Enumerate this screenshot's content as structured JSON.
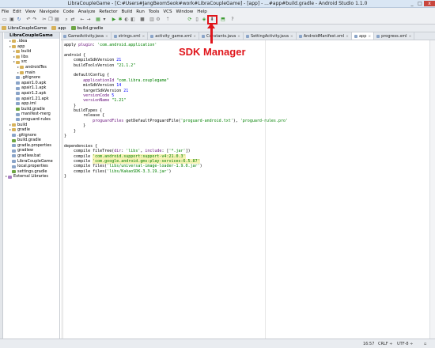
{
  "window": {
    "title": "LibraCoupleGame - [C:#Users#JangBeomSeok#work#LibraCoupleGame] - [app] - ...#app#build.gradle - Android Studio 1.1.0",
    "controls": [
      "_",
      "□",
      "x"
    ]
  },
  "menu": [
    "File",
    "Edit",
    "View",
    "Navigate",
    "Code",
    "Analyze",
    "Refactor",
    "Build",
    "Run",
    "Tools",
    "VCS",
    "Window",
    "Help"
  ],
  "annotation": {
    "label": "SDK Manager",
    "color": "#e0151b"
  },
  "breadcrumbs": [
    "LibraCoupleGame",
    "app",
    "build.gradle"
  ],
  "project_tree": {
    "header": "LibraCoupleGame",
    "items": [
      {
        "label": ".idea",
        "depth": 1,
        "icon": "folder"
      },
      {
        "label": "app",
        "depth": 1,
        "icon": "folder"
      },
      {
        "label": "build",
        "depth": 2,
        "icon": "folder"
      },
      {
        "label": "libs",
        "depth": 2,
        "icon": "folder"
      },
      {
        "label": "src",
        "depth": 2,
        "icon": "folder"
      },
      {
        "label": "androidTes",
        "depth": 3,
        "icon": "folder"
      },
      {
        "label": "main",
        "depth": 3,
        "icon": "folder"
      },
      {
        "label": ".gitignore",
        "depth": 2,
        "icon": "file"
      },
      {
        "label": "apair1.0.apk",
        "depth": 2,
        "icon": "file"
      },
      {
        "label": "apair1.1.apk",
        "depth": 2,
        "icon": "file"
      },
      {
        "label": "apair1.2.apk",
        "depth": 2,
        "icon": "file"
      },
      {
        "label": "apair1.21.apk",
        "depth": 2,
        "icon": "file"
      },
      {
        "label": "app.iml",
        "depth": 2,
        "icon": "file"
      },
      {
        "label": "build.gradle",
        "depth": 2,
        "icon": "gradle"
      },
      {
        "label": "manifest-merg",
        "depth": 2,
        "icon": "file"
      },
      {
        "label": "proguard-rules",
        "depth": 2,
        "icon": "file"
      },
      {
        "label": "build",
        "depth": 1,
        "icon": "folder"
      },
      {
        "label": "gradle",
        "depth": 1,
        "icon": "folder"
      },
      {
        "label": ".gitignore",
        "depth": 1,
        "icon": "file"
      },
      {
        "label": "build.gradle",
        "depth": 1,
        "icon": "gradle"
      },
      {
        "label": "gradle.properties",
        "depth": 1,
        "icon": "file"
      },
      {
        "label": "gradlew",
        "depth": 1,
        "icon": "file"
      },
      {
        "label": "gradlew.bat",
        "depth": 1,
        "icon": "file"
      },
      {
        "label": "LibraCoupleGame",
        "depth": 1,
        "icon": "file"
      },
      {
        "label": "local.properties",
        "depth": 1,
        "icon": "file"
      },
      {
        "label": "settings.gradle",
        "depth": 1,
        "icon": "gradle"
      },
      {
        "label": "External Libraries",
        "depth": 0,
        "icon": "lib"
      }
    ]
  },
  "tabs": [
    {
      "label": "GameActivity.java"
    },
    {
      "label": "strings.xml"
    },
    {
      "label": "activity_game.xml"
    },
    {
      "label": "Constants.java"
    },
    {
      "label": "SettingActivity.java"
    },
    {
      "label": "AndroidManifest.xml"
    },
    {
      "label": "app",
      "active": true
    },
    {
      "label": "progress.xml"
    }
  ],
  "code_lines": [
    [
      [
        "fn",
        "apply "
      ],
      [
        "prop",
        "plugin"
      ],
      [
        "fn",
        ": "
      ],
      [
        "str",
        "'com.android.application'"
      ]
    ],
    [],
    [
      [
        "fn",
        "android {"
      ]
    ],
    [
      [
        "fn",
        "    compileSdkVersion "
      ],
      [
        "num",
        "21"
      ]
    ],
    [
      [
        "fn",
        "    buildToolsVersion "
      ],
      [
        "str",
        "\"21.1.2\""
      ]
    ],
    [],
    [
      [
        "fn",
        "    defaultConfig {"
      ]
    ],
    [
      [
        "fn",
        "        "
      ],
      [
        "prop",
        "applicationId"
      ],
      [
        "fn",
        " "
      ],
      [
        "str",
        "\"com.libra.couplegame\""
      ]
    ],
    [
      [
        "fn",
        "        minSdkVersion "
      ],
      [
        "num",
        "14"
      ]
    ],
    [
      [
        "fn",
        "        targetSdkVersion "
      ],
      [
        "num",
        "21"
      ]
    ],
    [
      [
        "fn",
        "        "
      ],
      [
        "prop",
        "versionCode"
      ],
      [
        "fn",
        " "
      ],
      [
        "num",
        "5"
      ]
    ],
    [
      [
        "fn",
        "        "
      ],
      [
        "prop",
        "versionName"
      ],
      [
        "fn",
        " "
      ],
      [
        "str",
        "\"1.21\""
      ]
    ],
    [
      [
        "fn",
        "    }"
      ]
    ],
    [
      [
        "fn",
        "    buildTypes {"
      ]
    ],
    [
      [
        "fn",
        "        release {"
      ]
    ],
    [
      [
        "fn",
        "            "
      ],
      [
        "prop",
        "proguardFiles"
      ],
      [
        "fn",
        " getDefaultProguardFile("
      ],
      [
        "str",
        "'proguard-android.txt'"
      ],
      [
        "fn",
        "), "
      ],
      [
        "str",
        "'proguard-rules.pro'"
      ]
    ],
    [
      [
        "fn",
        "        }"
      ]
    ],
    [
      [
        "fn",
        "    }"
      ]
    ],
    [
      [
        "fn",
        "}"
      ]
    ],
    [],
    [
      [
        "fn",
        "dependencies {"
      ]
    ],
    [
      [
        "fn",
        "    compile fileTree("
      ],
      [
        "prop",
        "dir"
      ],
      [
        "fn",
        ": "
      ],
      [
        "str",
        "'libs'"
      ],
      [
        "fn",
        ", "
      ],
      [
        "prop",
        "include"
      ],
      [
        "fn",
        ": ["
      ],
      [
        "str",
        "'*.jar'"
      ],
      [
        "fn",
        "])"
      ]
    ],
    [
      [
        "fn",
        "    compile "
      ],
      [
        "str-hl",
        "'com.android.support:support-v4:21.0.3'"
      ]
    ],
    [
      [
        "fn",
        "    compile "
      ],
      [
        "str-hl",
        "'com.google.android.gms:play-services:6.5.87'"
      ]
    ],
    [
      [
        "fn",
        "    compile files("
      ],
      [
        "str",
        "'libs/universal-image-loader-1.9.0.jar'"
      ],
      [
        "fn",
        ")"
      ]
    ],
    [
      [
        "fn",
        "    compile files("
      ],
      [
        "str",
        "'libs/KakaoSDK-3.3.19.jar'"
      ],
      [
        "fn",
        ")"
      ]
    ],
    [
      [
        "fn",
        "}"
      ]
    ]
  ],
  "status": {
    "position": "16:57",
    "line_sep": "CRLF ÷",
    "encoding": "UTF-8 ÷"
  }
}
